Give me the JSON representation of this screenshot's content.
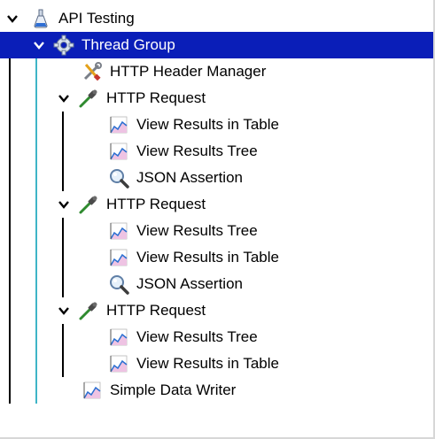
{
  "tree": {
    "root": {
      "label": "API Testing",
      "icon": "flask-icon"
    },
    "thread_group": {
      "label": "Thread Group",
      "icon": "gear-icon",
      "selected": true
    },
    "header_manager": {
      "label": "HTTP Header Manager",
      "icon": "wrench-screwdriver-icon"
    },
    "requests": [
      {
        "label": "HTTP Request",
        "icon": "pipette-icon",
        "children": [
          {
            "label": "View Results in Table",
            "icon": "graph-icon"
          },
          {
            "label": "View Results Tree",
            "icon": "graph-icon"
          },
          {
            "label": "JSON Assertion",
            "icon": "magnifier-icon"
          }
        ]
      },
      {
        "label": "HTTP Request",
        "icon": "pipette-icon",
        "children": [
          {
            "label": "View Results Tree",
            "icon": "graph-icon"
          },
          {
            "label": "View Results in Table",
            "icon": "graph-icon"
          },
          {
            "label": "JSON Assertion",
            "icon": "magnifier-icon"
          }
        ]
      },
      {
        "label": "HTTP Request",
        "icon": "pipette-icon",
        "children": [
          {
            "label": "View Results Tree",
            "icon": "graph-icon"
          },
          {
            "label": "View Results in Table",
            "icon": "graph-icon"
          }
        ]
      }
    ],
    "data_writer": {
      "label": "Simple Data Writer",
      "icon": "graph-icon"
    }
  },
  "colors": {
    "selection": "#0a1eb8",
    "guide_teal": "#3fb5c7",
    "guide_black": "#000000"
  }
}
